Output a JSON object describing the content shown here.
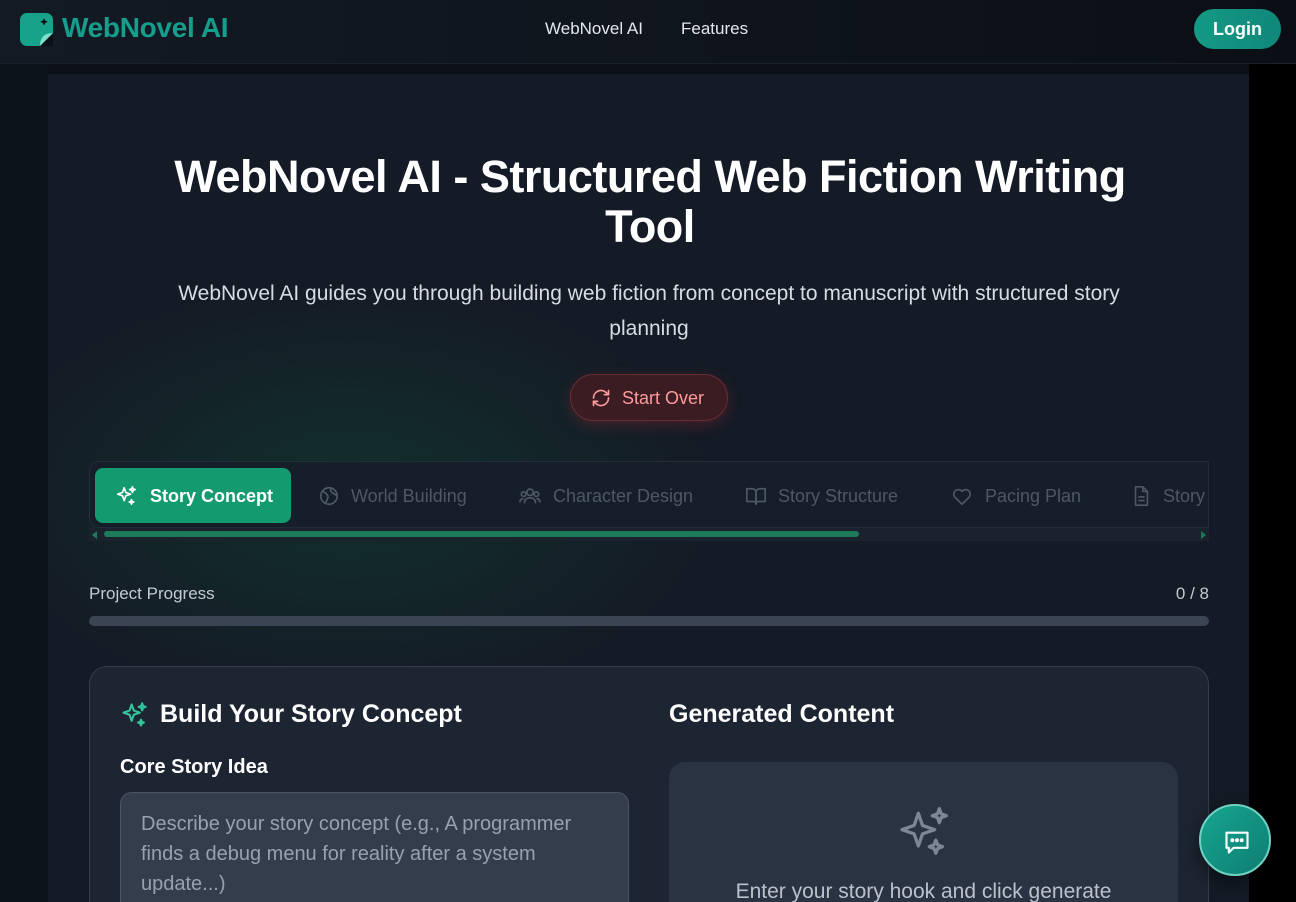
{
  "nav": {
    "brand": "WebNovel AI",
    "links": [
      "WebNovel AI",
      "Features"
    ],
    "login_label": "Login"
  },
  "hero": {
    "title": "WebNovel AI - Structured Web Fiction Writing Tool",
    "subtitle": "WebNovel AI guides you through building web fiction from concept to manuscript with structured story planning",
    "start_over_label": "Start Over"
  },
  "tabs": [
    {
      "label": "Story Concept",
      "icon": "sparkles-icon",
      "active": true
    },
    {
      "label": "World Building",
      "icon": "globe-icon",
      "active": false
    },
    {
      "label": "Character Design",
      "icon": "users-icon",
      "active": false
    },
    {
      "label": "Story Structure",
      "icon": "book-open-icon",
      "active": false
    },
    {
      "label": "Pacing Plan",
      "icon": "heart-icon",
      "active": false
    },
    {
      "label": "Story",
      "icon": "file-icon",
      "active": false
    }
  ],
  "progress": {
    "label": "Project Progress",
    "count_text": "0 / 8",
    "fraction": 0
  },
  "concept_card": {
    "title": "Build Your Story Concept",
    "field_label": "Core Story Idea",
    "field_placeholder": "Describe your story concept (e.g., A programmer finds a debug menu for reality after a system update...)",
    "field_value": ""
  },
  "generated": {
    "title": "Generated Content",
    "hint": "Enter your story hook and click generate"
  },
  "colors": {
    "accent": "#139a6e",
    "brand": "#169e8c",
    "danger": "#ff9b9b"
  }
}
